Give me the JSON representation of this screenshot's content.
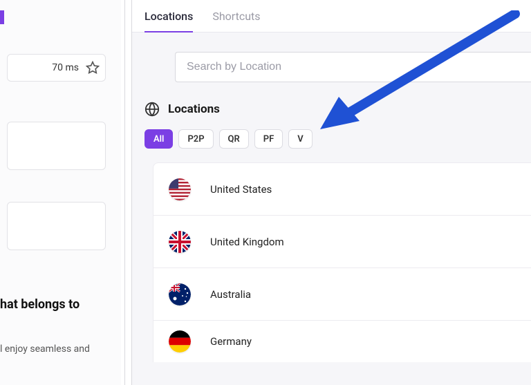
{
  "left_panel": {
    "latency": "70 ms",
    "heading_fragment": "hat belongs to",
    "sub_fragment": "l enjoy seamless and"
  },
  "tabs": {
    "locations": "Locations",
    "shortcuts": "Shortcuts"
  },
  "search": {
    "placeholder": "Search by Location"
  },
  "locations_header": "Locations",
  "chips": {
    "all": "All",
    "p2p": "P2P",
    "qr": "QR",
    "pf": "PF",
    "v": "V"
  },
  "countries": {
    "us": "United States",
    "uk": "United Kingdom",
    "au": "Australia",
    "de": "Germany"
  }
}
